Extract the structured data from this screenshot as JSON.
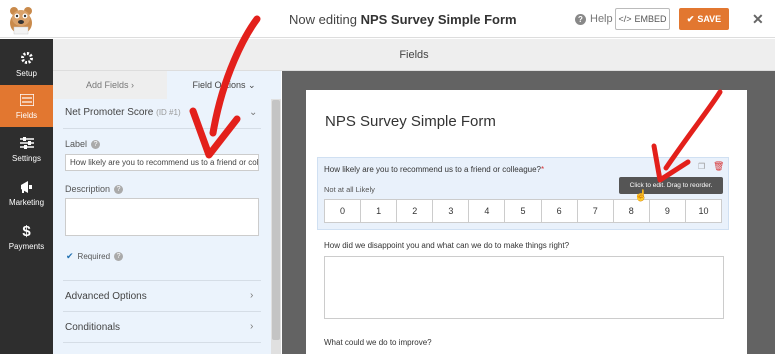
{
  "topbar": {
    "title_prefix": "Now editing",
    "form_name": "NPS Survey Simple Form",
    "help_label": "Help",
    "embed_label": "EMBED",
    "save_label": "SAVE"
  },
  "sidebar": {
    "items": [
      {
        "label": "Setup",
        "icon": "gear-icon"
      },
      {
        "label": "Fields",
        "icon": "list-icon"
      },
      {
        "label": "Settings",
        "icon": "sliders-icon"
      },
      {
        "label": "Marketing",
        "icon": "megaphone-icon"
      },
      {
        "label": "Payments",
        "icon": "dollar-icon"
      }
    ]
  },
  "panel": {
    "header": "Fields",
    "tab_add": "Add Fields",
    "tab_options": "Field Options",
    "field_name": "Net Promoter Score",
    "field_id": "(ID #1)",
    "label_caption": "Label",
    "label_value": "How likely are you to recommend us to a friend or colleague?",
    "description_caption": "Description",
    "required_label": "Required",
    "advanced_options": "Advanced Options",
    "conditionals": "Conditionals"
  },
  "preview": {
    "form_title": "NPS Survey Simple Form",
    "q1": "How likely are you to recommend us to a friend or colleague?",
    "q1_required_mark": "*",
    "not_likely": "Not at all Likely",
    "scale": [
      "0",
      "1",
      "2",
      "3",
      "4",
      "5",
      "6",
      "7",
      "8",
      "9",
      "10"
    ],
    "tooltip": "Click to edit. Drag to reorder.",
    "q2": "How did we disappoint you and what can we do to make things right?",
    "q3": "What could we do to improve?"
  },
  "colors": {
    "accent": "#e27730",
    "sidebar_bg": "#2e2e2e",
    "options_panel_bg": "#ebf3fc",
    "preview_bg": "#636363",
    "arrow": "#e3201b"
  }
}
